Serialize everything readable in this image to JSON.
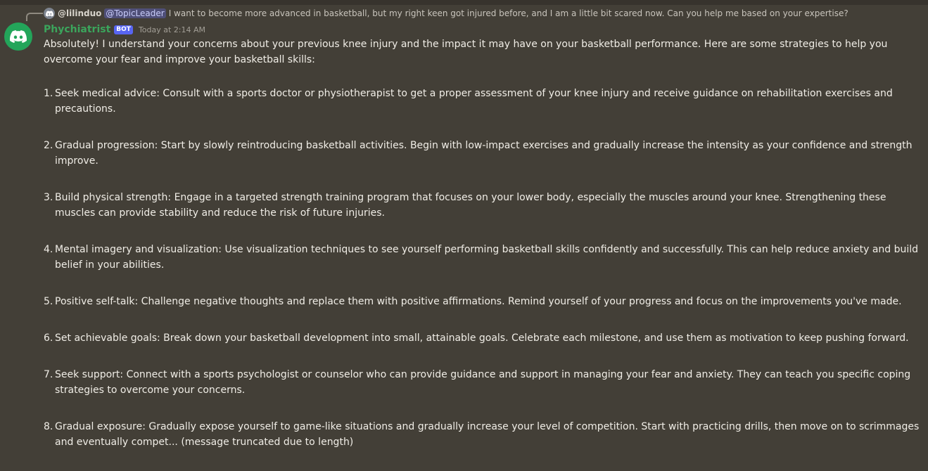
{
  "reply": {
    "username": "@lilinduo",
    "mention": "@TopicLeader",
    "text": "I want to become more advanced in basketball, but my right keen got injured before, and I am a little bit scared now. Can you help me based on your expertise?"
  },
  "author": {
    "name": "Phychiatrist",
    "badge": "BOT",
    "timestamp": "Today at 2:14 AM",
    "avatar_icon": "discord-logo-icon",
    "name_color": "#3ba55c"
  },
  "message": {
    "intro": "Absolutely! I understand your concerns about your previous knee injury and the impact it may have on your basketball performance. Here are some strategies to help you overcome your fear and improve your basketball skills:",
    "items": [
      {
        "num": "1.",
        "text": "Seek medical advice: Consult with a sports doctor or physiotherapist to get a proper assessment of your knee injury and receive guidance on rehabilitation exercises and precautions."
      },
      {
        "num": "2.",
        "text": "Gradual progression: Start by slowly reintroducing basketball activities. Begin with low-impact exercises and gradually increase the intensity as your confidence and strength improve."
      },
      {
        "num": "3.",
        "text": "Build physical strength: Engage in a targeted strength training program that focuses on your lower body, especially the muscles around your knee. Strengthening these muscles can provide stability and reduce the risk of future injuries."
      },
      {
        "num": "4.",
        "text": "Mental imagery and visualization: Use visualization techniques to see yourself performing basketball skills confidently and successfully. This can help reduce anxiety and build belief in your abilities."
      },
      {
        "num": "5.",
        "text": "Positive self-talk: Challenge negative thoughts and replace them with positive affirmations. Remind yourself of your progress and focus on the improvements you've made."
      },
      {
        "num": "6.",
        "text": "Set achievable goals: Break down your basketball development into small, attainable goals. Celebrate each milestone, and use them as motivation to keep pushing forward."
      },
      {
        "num": "7.",
        "text": "Seek support: Connect with a sports psychologist or counselor who can provide guidance and support in managing your fear and anxiety. They can teach you specific coping strategies to overcome your concerns."
      },
      {
        "num": "8.",
        "text": "Gradual exposure: Gradually expose yourself to game-like situations and gradually increase your level of competition. Start with practicing drills, then move on to scrimmages and eventually compet... (message truncated due to length)"
      }
    ]
  }
}
